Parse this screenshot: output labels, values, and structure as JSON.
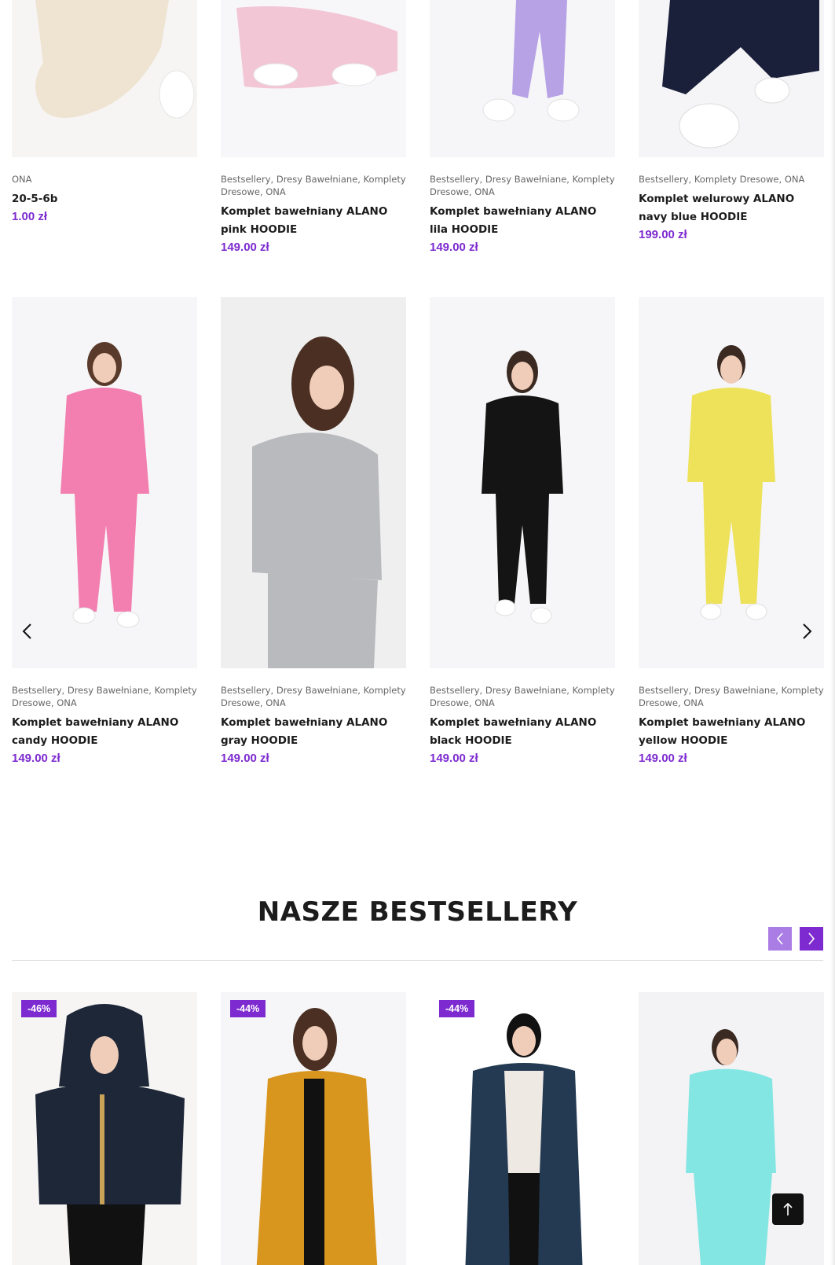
{
  "colors": {
    "accent": "#7d2bd0",
    "accent_light": "#a97de4",
    "title": "#1c1c1c",
    "meta": "#666666"
  },
  "row1": [
    {
      "cats": "ONA",
      "title": "20-5-6b",
      "price": "1.00 zł",
      "swatch": "#efe3d2"
    },
    {
      "cats": "Bestsellery, Dresy Bawełniane, Komplety Dresowe, ONA",
      "title": "Komplet bawełniany ALANO pink HOODIE",
      "price": "149.00 zł",
      "swatch": "#f2c6d5"
    },
    {
      "cats": "Bestsellery, Dresy Bawełniane, Komplety Dresowe, ONA",
      "title": "Komplet bawełniany ALANO lila HOODIE",
      "price": "149.00 zł",
      "swatch": "#b8a2e6"
    },
    {
      "cats": "Bestsellery, Komplety Dresowe, ONA",
      "title": "Komplet welurowy ALANO navy blue HOODIE",
      "price": "199.00 zł",
      "swatch": "#1a1f3a"
    }
  ],
  "row2": [
    {
      "cats": "Bestsellery, Dresy Bawełniane, Komplety Dresowe, ONA",
      "title": "Komplet bawełniany ALANO candy HOODIE",
      "price": "149.00 zł",
      "swatch": "#f27fb0"
    },
    {
      "cats": "Bestsellery, Dresy Bawełniane, Komplety Dresowe, ONA",
      "title": "Komplet bawełniany ALANO gray HOODIE",
      "price": "149.00 zł",
      "swatch": "#b9babe"
    },
    {
      "cats": "Bestsellery, Dresy Bawełniane, Komplety Dresowe, ONA",
      "title": "Komplet bawełniany ALANO black HOODIE",
      "price": "149.00 zł",
      "swatch": "#141414"
    },
    {
      "cats": "Bestsellery, Dresy Bawełniane, Komplety Dresowe, ONA",
      "title": "Komplet bawełniany ALANO yellow HOODIE",
      "price": "149.00 zł",
      "swatch": "#ede25a"
    }
  ],
  "section": {
    "title": "NASZE BESTSELLERY"
  },
  "row3": [
    {
      "badge": "-46%",
      "swatch": "#1d2738"
    },
    {
      "badge": "-44%",
      "swatch": "#d9961e"
    },
    {
      "badge": "-44%",
      "swatch": "#243a52"
    },
    {
      "badge": "",
      "swatch": "#84e6e2"
    }
  ],
  "icons": {
    "prev": "chevron-left-icon",
    "next": "chevron-right-icon",
    "totop": "arrow-up-icon"
  }
}
